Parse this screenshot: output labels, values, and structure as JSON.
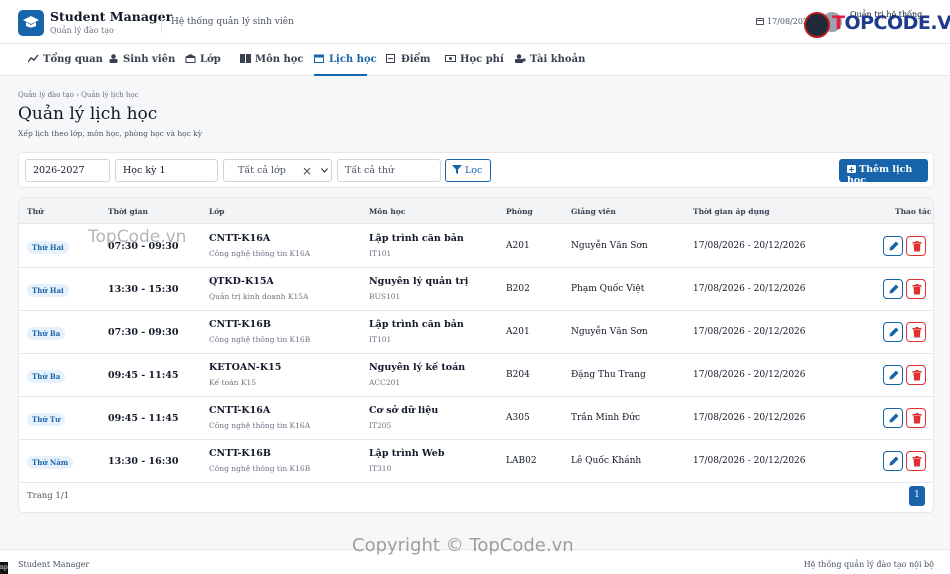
{
  "app": {
    "name": "Student Manager",
    "subtitle": "Quản lý đào tạo",
    "system_title": "Hệ thống quản lý sinh viên",
    "date": "17/08/2026",
    "user_role": "Quản trị hệ thống"
  },
  "watermark": {
    "logo_text": "TOPCODE.VN",
    "mid": "TopCode.vn",
    "copyright": "Copyright © TopCode.vn"
  },
  "nav": [
    {
      "label": "Tổng quan",
      "icon": "chart-icon"
    },
    {
      "label": "Sinh viên",
      "icon": "student-icon"
    },
    {
      "label": "Lớp",
      "icon": "school-icon"
    },
    {
      "label": "Môn học",
      "icon": "book-icon"
    },
    {
      "label": "Lịch học",
      "icon": "calendar-icon",
      "active": true
    },
    {
      "label": "Điểm",
      "icon": "grade-icon"
    },
    {
      "label": "Học phí",
      "icon": "money-icon"
    },
    {
      "label": "Tài khoản",
      "icon": "user-icon"
    }
  ],
  "breadcrumb": {
    "parent": "Quản lý đào tạo",
    "current": "Quản lý lịch học"
  },
  "page": {
    "title": "Quản lý lịch học",
    "description": "Xếp lịch theo lớp, môn học, phòng học và học kỳ"
  },
  "filters": {
    "year": "2026-2027",
    "semester": "Học kỳ 1",
    "class": "Tất cả lớp",
    "weekday": "Tất cả thứ",
    "filter_label": "Lọc",
    "add_label": "Thêm lịch học"
  },
  "table": {
    "headers": {
      "day": "Thứ",
      "time": "Thời gian",
      "class": "Lớp",
      "subject": "Môn học",
      "room": "Phòng",
      "teacher": "Giảng viên",
      "period": "Thời gian áp dụng",
      "actions": "Thao tác"
    },
    "rows": [
      {
        "day": "Thứ Hai",
        "time": "07:30 - 09:30",
        "class_code": "CNTT-K16A",
        "class_name": "Công nghệ thông tin K16A",
        "subject": "Lập trình căn bản",
        "subject_code": "IT101",
        "room": "A201",
        "teacher": "Nguyễn Văn Sơn",
        "period": "17/08/2026 - 20/12/2026"
      },
      {
        "day": "Thứ Hai",
        "time": "13:30 - 15:30",
        "class_code": "QTKD-K15A",
        "class_name": "Quản trị kinh doanh K15A",
        "subject": "Nguyên lý quản trị",
        "subject_code": "BUS101",
        "room": "B202",
        "teacher": "Phạm Quốc Việt",
        "period": "17/08/2026 - 20/12/2026"
      },
      {
        "day": "Thứ Ba",
        "time": "07:30 - 09:30",
        "class_code": "CNTT-K16B",
        "class_name": "Công nghệ thông tin K16B",
        "subject": "Lập trình căn bản",
        "subject_code": "IT101",
        "room": "A201",
        "teacher": "Nguyễn Văn Sơn",
        "period": "17/08/2026 - 20/12/2026"
      },
      {
        "day": "Thứ Ba",
        "time": "09:45 - 11:45",
        "class_code": "KETOAN-K15",
        "class_name": "Kế toán K15",
        "subject": "Nguyên lý kế toán",
        "subject_code": "ACC201",
        "room": "B204",
        "teacher": "Đặng Thu Trang",
        "period": "17/08/2026 - 20/12/2026"
      },
      {
        "day": "Thứ Tư",
        "time": "09:45 - 11:45",
        "class_code": "CNTT-K16A",
        "class_name": "Công nghệ thông tin K16A",
        "subject": "Cơ sở dữ liệu",
        "subject_code": "IT205",
        "room": "A305",
        "teacher": "Trần Minh Đức",
        "period": "17/08/2026 - 20/12/2026"
      },
      {
        "day": "Thứ Năm",
        "time": "13:30 - 16:30",
        "class_code": "CNTT-K16B",
        "class_name": "Công nghệ thông tin K16B",
        "subject": "Lập trình Web",
        "subject_code": "IT310",
        "room": "LAB02",
        "teacher": "Lê Quốc Khánh",
        "period": "17/08/2026 - 20/12/2026"
      }
    ]
  },
  "pagination": {
    "text": "Trang 1/1",
    "current": "1"
  },
  "footer": {
    "left": "Student Manager",
    "right": "Hệ thống quản lý đào tạo nội bộ",
    "badge": "np"
  },
  "colors": {
    "primary": "#1864ab",
    "danger": "#e03131"
  }
}
